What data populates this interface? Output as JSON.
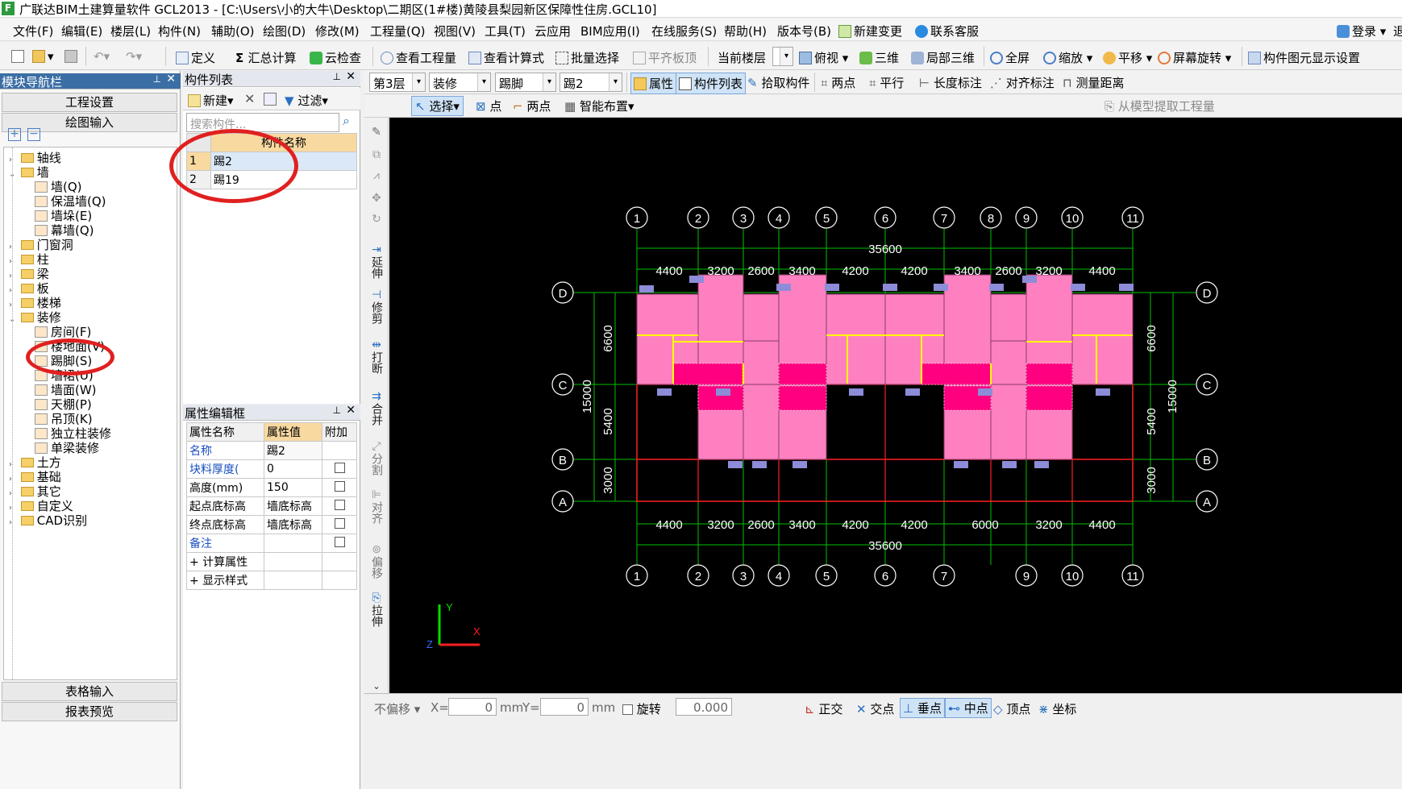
{
  "window": {
    "title": "广联达BIM土建算量软件 GCL2013 - [C:\\Users\\小的大牛\\Desktop\\二期区(1#楼)黄陵县梨园新区保障性住房.GCL10]",
    "logo": "F"
  },
  "menu": [
    "文件(F)",
    "编辑(E)",
    "楼层(L)",
    "构件(N)",
    "辅助(O)",
    "绘图(D)",
    "修改(M)",
    "工程量(Q)",
    "视图(V)",
    "工具(T)",
    "云应用",
    "BIM应用(I)",
    "在线服务(S)",
    "帮助(H)",
    "版本号(B)",
    "新建变更",
    "联系客服",
    "登录",
    "退"
  ],
  "toolbar1": {
    "define": "定义",
    "sum": "汇总计算",
    "cloud_check": "云检查",
    "view_qty": "查看工程量",
    "view_formula": "查看计算式",
    "batch_select": "批量选择",
    "flat_top": "平齐板顶",
    "current_floor": "当前楼层",
    "top_view": "俯视",
    "three_d": "三维",
    "local_3d": "局部三维",
    "full_screen": "全屏",
    "zoom": "缩放",
    "pan": "平移",
    "screen_rotate": "屏幕旋转",
    "elem_display": "构件图元显示设置"
  },
  "toolbar2": {
    "floor": "第3层",
    "category": "装修",
    "type": "踢脚",
    "element": "踢2",
    "properties": "属性",
    "component_list": "构件列表",
    "pick": "拾取构件",
    "two_points": "两点",
    "parallel": "平行",
    "length_dim": "长度标注",
    "align_dim": "对齐标注",
    "measure": "测量距离"
  },
  "toolbar3": {
    "select": "选择",
    "point": "点",
    "two_points": "两点",
    "smart_place": "智能布置",
    "extract": "从模型提取工程量"
  },
  "nav": {
    "title": "模块导航栏",
    "project_settings": "工程设置",
    "drawing_input": "绘图输入",
    "table_input": "表格输入",
    "report_preview": "报表预览",
    "tree": [
      {
        "label": "轴线",
        "level": 0,
        "exp": "›",
        "type": "folder"
      },
      {
        "label": "墙",
        "level": 0,
        "exp": "⌄",
        "type": "folder"
      },
      {
        "label": "墙(Q)",
        "level": 1,
        "type": "leaf"
      },
      {
        "label": "保温墙(Q)",
        "level": 1,
        "type": "leaf"
      },
      {
        "label": "墙垛(E)",
        "level": 1,
        "type": "leaf"
      },
      {
        "label": "幕墙(Q)",
        "level": 1,
        "type": "leaf"
      },
      {
        "label": "门窗洞",
        "level": 0,
        "exp": "›",
        "type": "folder"
      },
      {
        "label": "柱",
        "level": 0,
        "exp": "›",
        "type": "folder"
      },
      {
        "label": "梁",
        "level": 0,
        "exp": "›",
        "type": "folder"
      },
      {
        "label": "板",
        "level": 0,
        "exp": "›",
        "type": "folder"
      },
      {
        "label": "楼梯",
        "level": 0,
        "exp": "›",
        "type": "folder"
      },
      {
        "label": "装修",
        "level": 0,
        "exp": "⌄",
        "type": "folder"
      },
      {
        "label": "房间(F)",
        "level": 1,
        "type": "leaf"
      },
      {
        "label": "楼地面(V)",
        "level": 1,
        "type": "leaf"
      },
      {
        "label": "踢脚(S)",
        "level": 1,
        "type": "leaf"
      },
      {
        "label": "墙裙(U)",
        "level": 1,
        "type": "leaf"
      },
      {
        "label": "墙面(W)",
        "level": 1,
        "type": "leaf"
      },
      {
        "label": "天棚(P)",
        "level": 1,
        "type": "leaf"
      },
      {
        "label": "吊顶(K)",
        "level": 1,
        "type": "leaf"
      },
      {
        "label": "独立柱装修",
        "level": 1,
        "type": "leaf"
      },
      {
        "label": "单梁装修",
        "level": 1,
        "type": "leaf"
      },
      {
        "label": "土方",
        "level": 0,
        "exp": "›",
        "type": "folder"
      },
      {
        "label": "基础",
        "level": 0,
        "exp": "›",
        "type": "folder"
      },
      {
        "label": "其它",
        "level": 0,
        "exp": "›",
        "type": "folder"
      },
      {
        "label": "自定义",
        "level": 0,
        "exp": "›",
        "type": "folder"
      },
      {
        "label": "CAD识别",
        "level": 0,
        "exp": "›",
        "type": "folder"
      }
    ]
  },
  "complist": {
    "title": "构件列表",
    "new": "新建",
    "filter": "过滤",
    "search_placeholder": "搜索构件...",
    "col_name": "构件名称",
    "rows": [
      {
        "n": "1",
        "name": "踢2"
      },
      {
        "n": "2",
        "name": "踢19"
      }
    ]
  },
  "props": {
    "title": "属性编辑框",
    "col_name": "属性名称",
    "col_value": "属性值",
    "col_attach": "附加",
    "rows": [
      {
        "name": "名称",
        "value": "踢2",
        "blue": true,
        "chk": false
      },
      {
        "name": "块料厚度(",
        "value": "0",
        "blue": true,
        "chk": true
      },
      {
        "name": "高度(mm)",
        "value": "150",
        "blue": false,
        "chk": true
      },
      {
        "name": "起点底标高",
        "value": "墙底标高",
        "blue": false,
        "chk": true
      },
      {
        "name": "终点底标高",
        "value": "墙底标高",
        "blue": false,
        "chk": true
      },
      {
        "name": "备注",
        "value": "",
        "blue": true,
        "chk": true
      },
      {
        "name": "+ 计算属性",
        "value": "",
        "blue": false,
        "chk": false
      },
      {
        "name": "+ 显示样式",
        "value": "",
        "blue": false,
        "chk": false
      }
    ]
  },
  "vtools": [
    "延伸",
    "修剪",
    "打断",
    "合并",
    "分割",
    "对齐",
    "偏移",
    "拉伸"
  ],
  "drawing": {
    "axes_top": [
      "1",
      "2",
      "3",
      "4",
      "5",
      "6",
      "7",
      "8",
      "9",
      "10",
      "11"
    ],
    "axes_bottom": [
      "1",
      "2",
      "3",
      "4",
      "5",
      "6",
      "7",
      "9",
      "10",
      "11"
    ],
    "rows": [
      "D",
      "C",
      "B",
      "A"
    ],
    "top_dims": [
      "4400",
      "3200",
      "2600",
      "3400",
      "4200",
      "4200",
      "3400",
      "2600",
      "3200",
      "4400"
    ],
    "bottom_dims": [
      "4400",
      "3200",
      "2600",
      "3400",
      "4200",
      "4200",
      "6000",
      "3200",
      "4400"
    ],
    "total": "35600",
    "left_dims": [
      "6600",
      "5400",
      "3000"
    ],
    "left_total": "15000",
    "colors": {
      "room": "#ff80c0",
      "room_dark": "#ff0080",
      "axis": "#00c000",
      "wall": "#ffff00",
      "beam": "#ff2020",
      "text": "#ffffff"
    }
  },
  "status": {
    "no_offset": "不偏移",
    "x_label": "X=",
    "x_val": "0",
    "y_label": "Y=",
    "y_val": "0",
    "unit": "mm",
    "rotate": "旋转",
    "rot_val": "0.000",
    "ortho": "正交",
    "intersection": "交点",
    "perpendicular": "垂点",
    "midpoint": "中点",
    "vertex": "顶点",
    "coord": "坐标"
  }
}
